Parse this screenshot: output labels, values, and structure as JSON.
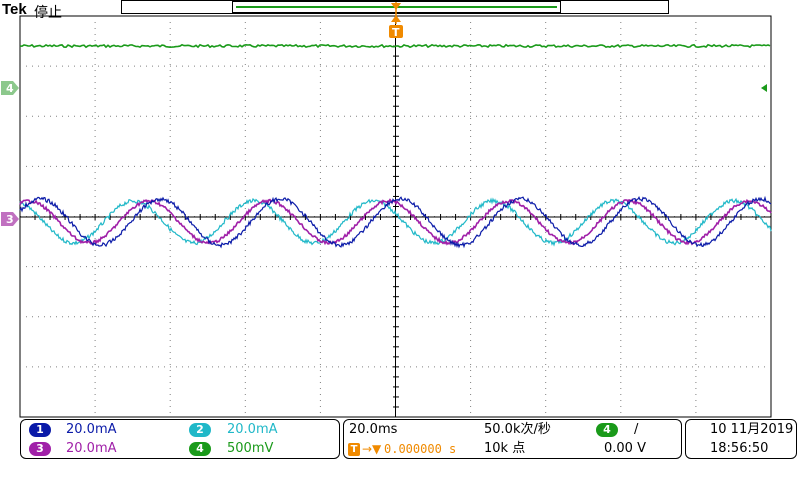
{
  "header": {
    "brand": "Tek",
    "status": "停止"
  },
  "colors": {
    "ch1": "#0a1aa8",
    "ch2": "#20b8c8",
    "ch3": "#a020a8",
    "ch4": "#1a9a1a",
    "trigger": "#f08a00",
    "grid": "#808080",
    "ref_marker": "#c070c0"
  },
  "channels": {
    "ch1": {
      "number": "1",
      "scale": "20.0mA"
    },
    "ch2": {
      "number": "2",
      "scale": "20.0mA"
    },
    "ch3": {
      "number": "3",
      "scale": "20.0mA"
    },
    "ch4": {
      "number": "4",
      "scale": "500mV"
    }
  },
  "markers": {
    "ch4_left": "4",
    "ch3_left": "3",
    "trigger_top": "T"
  },
  "timebase": {
    "scale": "20.0ms",
    "sample_rate": "50.0k次/秒",
    "record_length": "10k 点",
    "trigger_position": "0.000000 s",
    "trigger_icon": "T"
  },
  "trigger": {
    "source": "4",
    "slope": "/",
    "level": "0.00 V"
  },
  "datetime": {
    "date": "10 11月2019",
    "time": "18:56:50"
  }
}
